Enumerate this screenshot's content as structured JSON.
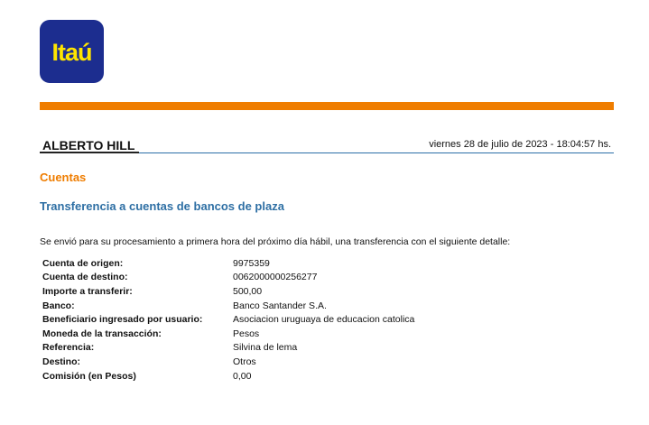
{
  "brand": {
    "logo_text": "Itaú",
    "logo_bg": "#1c2d8f",
    "logo_fg": "#ffe500",
    "accent": "#ef7d00",
    "link_blue": "#2e6fa4"
  },
  "header": {
    "user_name": "ALBERTO HILL",
    "datetime": "viernes 28 de julio de 2023 - 18:04:57 hs."
  },
  "section": {
    "title": "Cuentas",
    "subtitle": "Transferencia a cuentas de bancos de plaza"
  },
  "message": "Se envió para su procesamiento a primera hora del próximo día hábil, una transferencia con el siguiente detalle:",
  "details": [
    {
      "label": "Cuenta de origen:",
      "value": "9975359"
    },
    {
      "label": "Cuenta de destino:",
      "value": "0062000000256277"
    },
    {
      "label": "Importe a transferir:",
      "value": "500,00"
    },
    {
      "label": "Banco:",
      "value": "Banco Santander S.A."
    },
    {
      "label": "Beneficiario ingresado por usuario:",
      "value": "Asociacion uruguaya de educacion catolica"
    },
    {
      "label": "Moneda de la transacción:",
      "value": "Pesos"
    },
    {
      "label": "Referencia:",
      "value": "Silvina de lema"
    },
    {
      "label": "Destino:",
      "value": "Otros"
    },
    {
      "label": "Comisión (en Pesos)",
      "value": "0,00"
    }
  ]
}
